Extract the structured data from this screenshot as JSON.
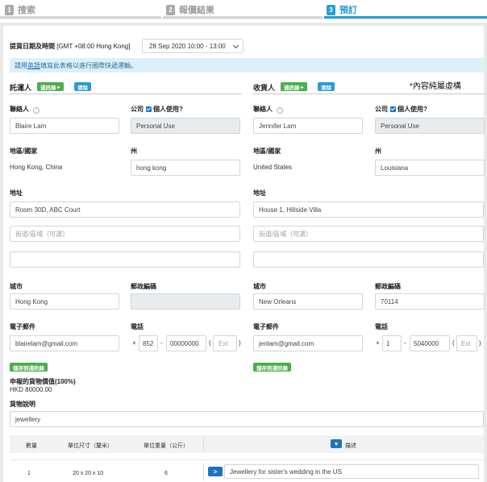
{
  "stepper": {
    "steps": [
      {
        "num": "1",
        "label": "搜索"
      },
      {
        "num": "2",
        "label": "報價結果"
      },
      {
        "num": "3",
        "label": "預訂"
      }
    ]
  },
  "pickup": {
    "label": "提貨日期及時間",
    "timezone": "[GMT +08:00 Hong Kong]",
    "value": "28 Sep 2020 10:00 - 13:00"
  },
  "banner": {
    "prefix": "請用",
    "link": "英語",
    "suffix": "填寫此表格以進行國際快遞運輸。"
  },
  "note": "*內容純屬虛構",
  "shipper": {
    "title": "託運人",
    "address_book_btn": "通訊錄",
    "clear_btn": "清除",
    "contact_label": "聯絡人",
    "contact_value": "Blaire Lam",
    "company_label": "公司",
    "personal_use_label": "個人使用?",
    "company_value": "Personal Use",
    "country_label": "地區/國家",
    "country_value": "Hong Kong, China",
    "state_label": "州",
    "state_value": "hong kong",
    "address_label": "地址",
    "address_line1": "Room 30D, ABC Court",
    "address_line2_placeholder": "街道/區域（可選）",
    "address_line3": "",
    "city_label": "城市",
    "city_value": "Hong Kong",
    "postcode_label": "郵政編碼",
    "postcode_value": "",
    "email_label": "電子郵件",
    "email_value": "blairelam@gmail.com",
    "phone_label": "電話",
    "phone_plus": "+",
    "phone_code": "852",
    "phone_dash": "-",
    "phone_number": "00000000",
    "phone_open_paren": "(",
    "phone_ext_placeholder": "Ext",
    "phone_close_paren": ")",
    "save_btn": "儲存到通訊錄"
  },
  "receiver": {
    "title": "收貨人",
    "address_book_btn": "通訊錄",
    "clear_btn": "清除",
    "contact_label": "聯絡人",
    "contact_value": "Jennifer Lam",
    "company_label": "公司",
    "personal_use_label": "個人使用?",
    "company_value": "Personal Use",
    "country_label": "地區/國家",
    "country_value": "United States",
    "state_label": "州",
    "state_value": "Louisiana",
    "address_label": "地址",
    "address_line1": "House 1, Hillside Villa",
    "address_line2_placeholder": "街道/區域（可選）",
    "address_line3": "",
    "city_label": "城市",
    "city_value": "New Orleans",
    "postcode_label": "郵政編碼",
    "postcode_value": "70114",
    "email_label": "電子郵件",
    "email_value": "jenlam@gmail.com",
    "phone_label": "電話",
    "phone_plus": "+",
    "phone_code": "1",
    "phone_dash": "-",
    "phone_number": "5040000",
    "phone_open_paren": "(",
    "phone_ext_placeholder": "Ext",
    "phone_close_paren": ")",
    "save_btn": "儲存到通訊錄"
  },
  "goods": {
    "declared_label": "申報的貨物價值(100%)",
    "declared_value": "HKD 80000.00",
    "description_label": "貨物說明",
    "description_value": "jewellery"
  },
  "packages": {
    "headers": {
      "qty": "數量",
      "size": "單位尺寸（釐米）",
      "weight": "單位重量（公斤）",
      "desc": "描述"
    },
    "rows": [
      {
        "qty": "1",
        "size": "20 x 20 x 10",
        "weight": "6",
        "desc": "Jewellery for sister's wedding in the US"
      }
    ]
  }
}
